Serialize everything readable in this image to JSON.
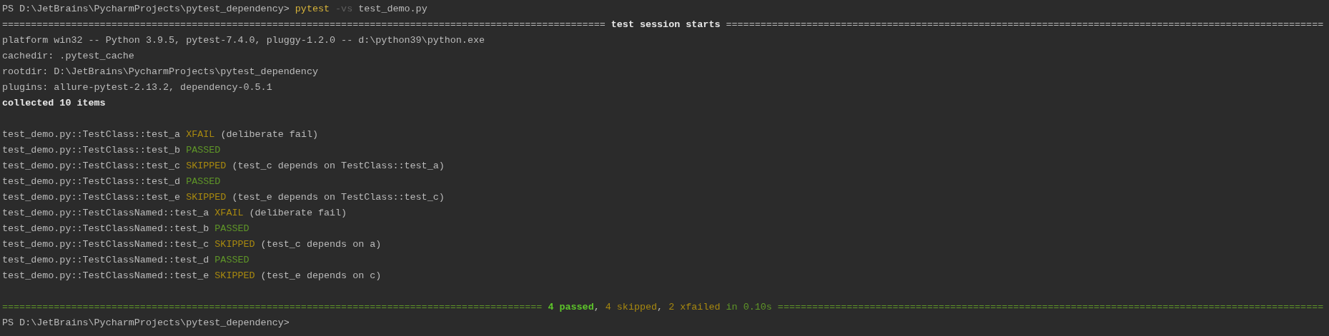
{
  "terminal": {
    "lines": [
      {
        "kind": "text",
        "segments": [
          {
            "kind": "plain",
            "text": "PS D:\\JetBrains\\PycharmProjects\\pytest_dependency> "
          },
          {
            "kind": "command",
            "text": "pytest"
          },
          {
            "kind": "option",
            "text": " -vs"
          },
          {
            "kind": "plain",
            "text": " test_demo.py"
          }
        ]
      },
      {
        "kind": "text",
        "segments": [
          {
            "kind": "plain",
            "text": "========================================================================================================="
          },
          {
            "kind": "bold",
            "text": " test session starts "
          },
          {
            "kind": "plain",
            "text": "========================================================================================================"
          }
        ]
      },
      {
        "kind": "text",
        "segments": [
          {
            "kind": "plain",
            "text": "platform win32 -- Python 3.9.5, pytest-7.4.0, pluggy-1.2.0 -- d:\\python39\\python.exe"
          }
        ]
      },
      {
        "kind": "text",
        "segments": [
          {
            "kind": "plain",
            "text": "cachedir: .pytest_cache"
          }
        ]
      },
      {
        "kind": "text",
        "segments": [
          {
            "kind": "plain",
            "text": "rootdir: D:\\JetBrains\\PycharmProjects\\pytest_dependency"
          }
        ]
      },
      {
        "kind": "text",
        "segments": [
          {
            "kind": "plain",
            "text": "plugins: allure-pytest-2.13.2, dependency-0.5.1"
          }
        ]
      },
      {
        "kind": "text",
        "segments": [
          {
            "kind": "bold",
            "text": "collected 10 items"
          }
        ]
      },
      {
        "kind": "blank"
      },
      {
        "kind": "text",
        "segments": [
          {
            "kind": "plain",
            "text": "test_demo.py::TestClass::test_a "
          },
          {
            "kind": "warn",
            "text": "XFAIL"
          },
          {
            "kind": "plain",
            "text": " (deliberate fail)"
          }
        ]
      },
      {
        "kind": "text",
        "segments": [
          {
            "kind": "plain",
            "text": "test_demo.py::TestClass::test_b "
          },
          {
            "kind": "pass",
            "text": "PASSED"
          }
        ]
      },
      {
        "kind": "text",
        "segments": [
          {
            "kind": "plain",
            "text": "test_demo.py::TestClass::test_c "
          },
          {
            "kind": "warn",
            "text": "SKIPPED"
          },
          {
            "kind": "plain",
            "text": " (test_c depends on TestClass::test_a)"
          }
        ]
      },
      {
        "kind": "text",
        "segments": [
          {
            "kind": "plain",
            "text": "test_demo.py::TestClass::test_d "
          },
          {
            "kind": "pass",
            "text": "PASSED"
          }
        ]
      },
      {
        "kind": "text",
        "segments": [
          {
            "kind": "plain",
            "text": "test_demo.py::TestClass::test_e "
          },
          {
            "kind": "warn",
            "text": "SKIPPED"
          },
          {
            "kind": "plain",
            "text": " (test_e depends on TestClass::test_c)"
          }
        ]
      },
      {
        "kind": "text",
        "segments": [
          {
            "kind": "plain",
            "text": "test_demo.py::TestClassNamed::test_a "
          },
          {
            "kind": "warn",
            "text": "XFAIL"
          },
          {
            "kind": "plain",
            "text": " (deliberate fail)"
          }
        ]
      },
      {
        "kind": "text",
        "segments": [
          {
            "kind": "plain",
            "text": "test_demo.py::TestClassNamed::test_b "
          },
          {
            "kind": "pass",
            "text": "PASSED"
          }
        ]
      },
      {
        "kind": "text",
        "segments": [
          {
            "kind": "plain",
            "text": "test_demo.py::TestClassNamed::test_c "
          },
          {
            "kind": "warn",
            "text": "SKIPPED"
          },
          {
            "kind": "plain",
            "text": " (test_c depends on a)"
          }
        ]
      },
      {
        "kind": "text",
        "segments": [
          {
            "kind": "plain",
            "text": "test_demo.py::TestClassNamed::test_d "
          },
          {
            "kind": "pass",
            "text": "PASSED"
          }
        ]
      },
      {
        "kind": "text",
        "segments": [
          {
            "kind": "plain",
            "text": "test_demo.py::TestClassNamed::test_e "
          },
          {
            "kind": "warn",
            "text": "SKIPPED"
          },
          {
            "kind": "plain",
            "text": " (test_e depends on c)"
          }
        ]
      },
      {
        "kind": "blank"
      },
      {
        "kind": "text",
        "segments": [
          {
            "kind": "pass",
            "text": "============================================================================================== "
          },
          {
            "kind": "pass_bold",
            "text": "4 passed"
          },
          {
            "kind": "plain",
            "text": ", "
          },
          {
            "kind": "warn",
            "text": "4 skipped"
          },
          {
            "kind": "plain",
            "text": ", "
          },
          {
            "kind": "warn",
            "text": "2 xfailed"
          },
          {
            "kind": "pass",
            "text": " in 0.10s ==============================================================================================="
          }
        ]
      },
      {
        "kind": "text",
        "segments": [
          {
            "kind": "plain",
            "text": "PS D:\\JetBrains\\PycharmProjects\\pytest_dependency>"
          }
        ]
      }
    ]
  }
}
